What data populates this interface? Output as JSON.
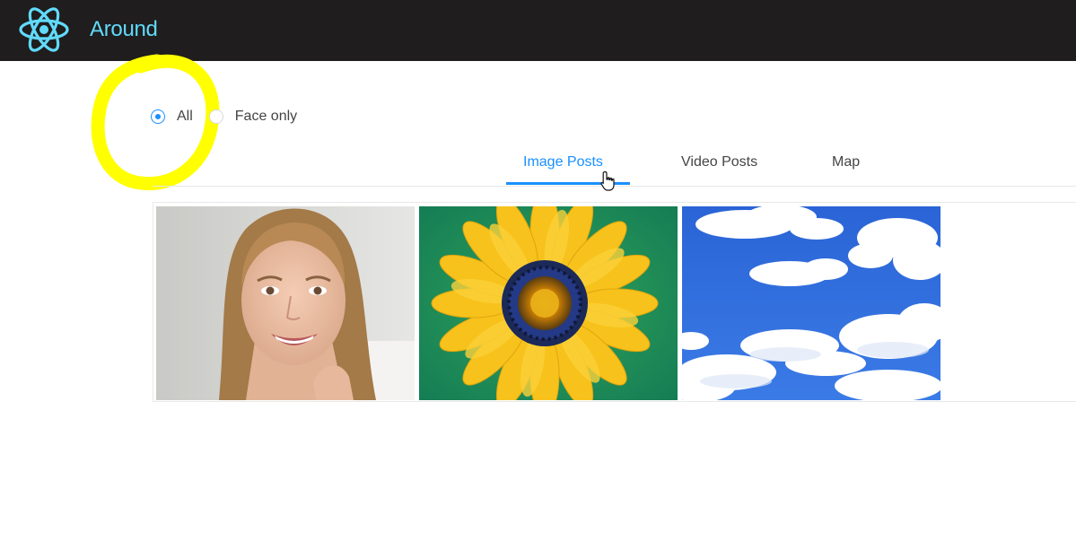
{
  "header": {
    "app_title": "Around",
    "logo_icon": "react-atom-icon",
    "bg_color": "#1f1d1d",
    "accent_color": "#61dafb"
  },
  "filter": {
    "options": [
      {
        "label": "All",
        "checked": true
      },
      {
        "label": "Face only",
        "checked": false
      }
    ]
  },
  "tabs": [
    {
      "label": "Image Posts",
      "active": true
    },
    {
      "label": "Video Posts",
      "active": false
    },
    {
      "label": "Map",
      "active": false
    }
  ],
  "gallery": {
    "images": [
      {
        "subject": "smiling-woman"
      },
      {
        "subject": "yellow-sunflower"
      },
      {
        "subject": "blue-sky-clouds"
      }
    ]
  },
  "colors": {
    "primary": "#1890ff",
    "highlight_marker": "#ffff00"
  }
}
